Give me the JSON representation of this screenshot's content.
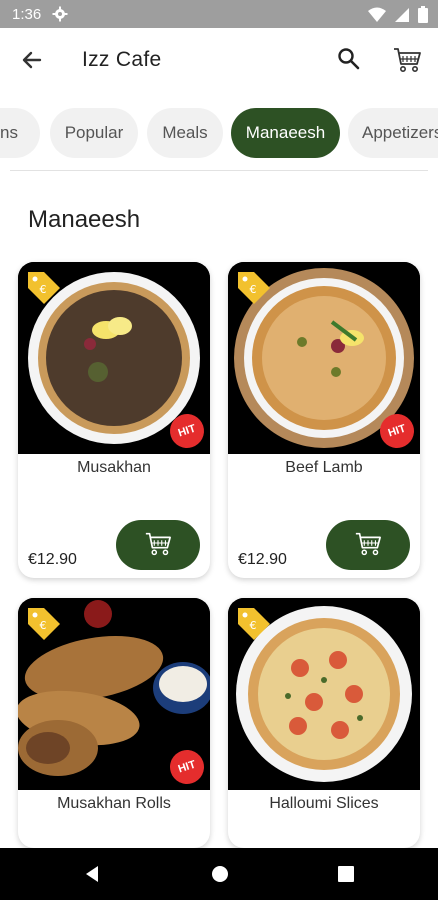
{
  "status_bar": {
    "time": "1:36"
  },
  "app_bar": {
    "title": "Izz Cafe"
  },
  "categories": [
    {
      "label": "ns"
    },
    {
      "label": "Popular"
    },
    {
      "label": "Meals"
    },
    {
      "label": "Manaeesh"
    },
    {
      "label": "Appetizers"
    }
  ],
  "section": {
    "title": "Manaeesh"
  },
  "products": [
    {
      "name": "Musakhan",
      "price": "€12.90",
      "badge": "HIT"
    },
    {
      "name": "Beef Lamb",
      "price": "€12.90",
      "badge": "HIT"
    },
    {
      "name": "Musakhan Rolls",
      "badge": "HIT"
    },
    {
      "name": "Halloumi Slices"
    }
  ],
  "colors": {
    "accent": "#2d5124",
    "hit_badge": "#e52d2d",
    "tag": "#f2c12e",
    "status_bar": "#9e9e9e"
  }
}
